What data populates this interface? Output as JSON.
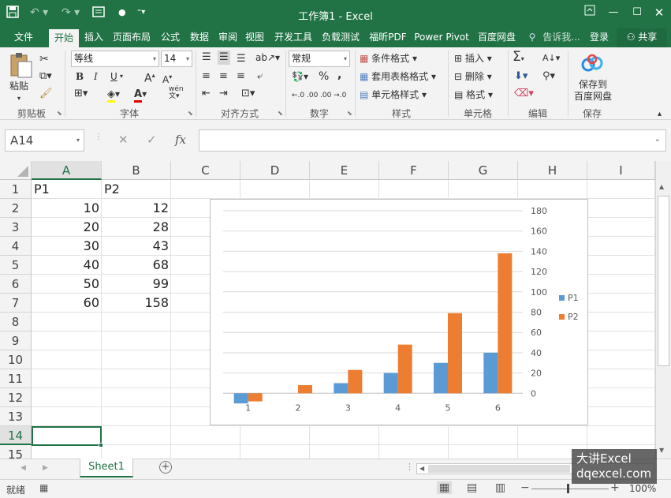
{
  "window": {
    "title": "工作簿1 - Excel"
  },
  "menu": {
    "tabs": [
      "文件",
      "开始",
      "插入",
      "页面布局",
      "公式",
      "数据",
      "审阅",
      "视图",
      "开发工具",
      "负载测试",
      "福昕PDF",
      "Power Pivot",
      "百度网盘"
    ],
    "active": "开始",
    "tell_me": "告诉我...",
    "login": "登录",
    "share": "共享"
  },
  "ribbon": {
    "clipboard": {
      "paste": "粘贴",
      "label": "剪贴板"
    },
    "font": {
      "name": "等线",
      "size": "14",
      "bold": "B",
      "italic": "I",
      "underline": "U",
      "grow": "A",
      "shrink": "A",
      "label": "字体",
      "pinyin": "wén"
    },
    "alignment": {
      "label": "对齐方式"
    },
    "number": {
      "format": "常规",
      "percent": "%",
      "comma": ",",
      "label": "数字",
      "inc": "←.0 .00",
      "dec": ".00 →.0"
    },
    "styles": {
      "conditional": "条件格式",
      "table": "套用表格格式",
      "cell": "单元格样式",
      "label": "样式"
    },
    "cells": {
      "insert": "插入",
      "delete": "删除",
      "format": "格式",
      "label": "单元格"
    },
    "editing": {
      "label": "编辑"
    },
    "save": {
      "button": "保存到\n百度网盘",
      "line1": "保存到",
      "line2": "百度网盘",
      "label": "保存"
    }
  },
  "formula_bar": {
    "name_box": "A14",
    "fx": "fx",
    "value": ""
  },
  "columns": [
    "A",
    "B",
    "C",
    "D",
    "E",
    "F",
    "G",
    "H",
    "I"
  ],
  "rows": [
    "1",
    "2",
    "3",
    "4",
    "5",
    "6",
    "7",
    "8",
    "9",
    "10",
    "11",
    "12",
    "13",
    "14",
    "15"
  ],
  "cells": {
    "A1": "P1",
    "B1": "P2",
    "A2": "10",
    "B2": "12",
    "A3": "20",
    "B3": "28",
    "A4": "30",
    "B4": "43",
    "A5": "40",
    "B5": "68",
    "A6": "50",
    "B6": "99",
    "A7": "60",
    "B7": "158"
  },
  "selected_cell": "A14",
  "chart_data": {
    "type": "bar",
    "categories": [
      "1",
      "2",
      "3",
      "4",
      "5",
      "6"
    ],
    "series": [
      {
        "name": "P1",
        "color": "#5b9bd5",
        "values": [
          -10,
          0,
          10,
          20,
          30,
          40
        ]
      },
      {
        "name": "P2",
        "color": "#ed7d31",
        "values": [
          -8,
          8,
          23,
          48,
          79,
          138
        ]
      }
    ],
    "y_ticks": [
      "180",
      "160",
      "140",
      "120",
      "100",
      "80",
      "60",
      "40",
      "20",
      "0"
    ],
    "ylim": [
      -20,
      180
    ],
    "y_axis_side": "right",
    "grid": true,
    "legend": "right"
  },
  "sheets": [
    "Sheet1"
  ],
  "status": {
    "ready": "就绪",
    "zoom": "100%"
  },
  "watermark": {
    "line1": "大讲Excel",
    "line2": "dqexcel.com"
  }
}
